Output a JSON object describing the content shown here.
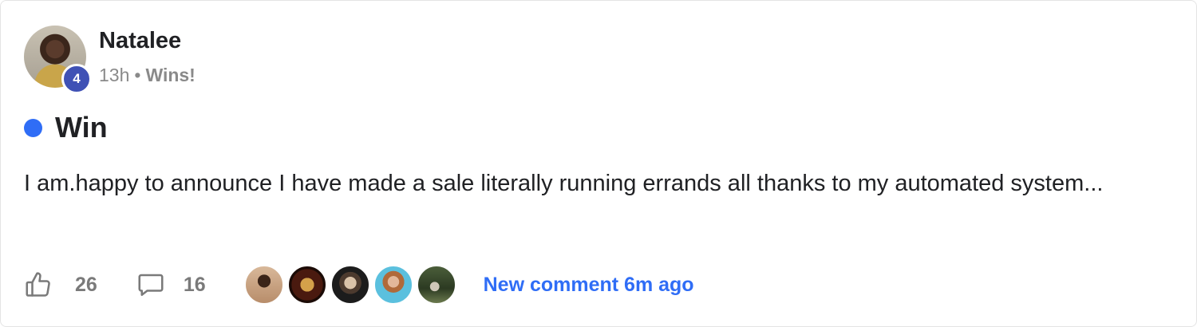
{
  "post": {
    "author": "Natalee",
    "level": "4",
    "time": "13h",
    "separator": "•",
    "category": "Wins!",
    "title": "Win",
    "body": "I am.happy to announce I have made a sale literally running errands all thanks to my automated system..."
  },
  "footer": {
    "likes": "26",
    "comments": "16",
    "new_comment": "New comment 6m ago",
    "commenter_avatars": [
      "avatar-1",
      "avatar-2",
      "avatar-3",
      "avatar-4",
      "avatar-5"
    ]
  },
  "colors": {
    "accent": "#2f6df6",
    "level_badge": "#3f51b5",
    "muted_text": "#8a8a8a"
  },
  "icons": {
    "like": "thumbs-up-icon",
    "comment": "speech-bubble-icon"
  }
}
